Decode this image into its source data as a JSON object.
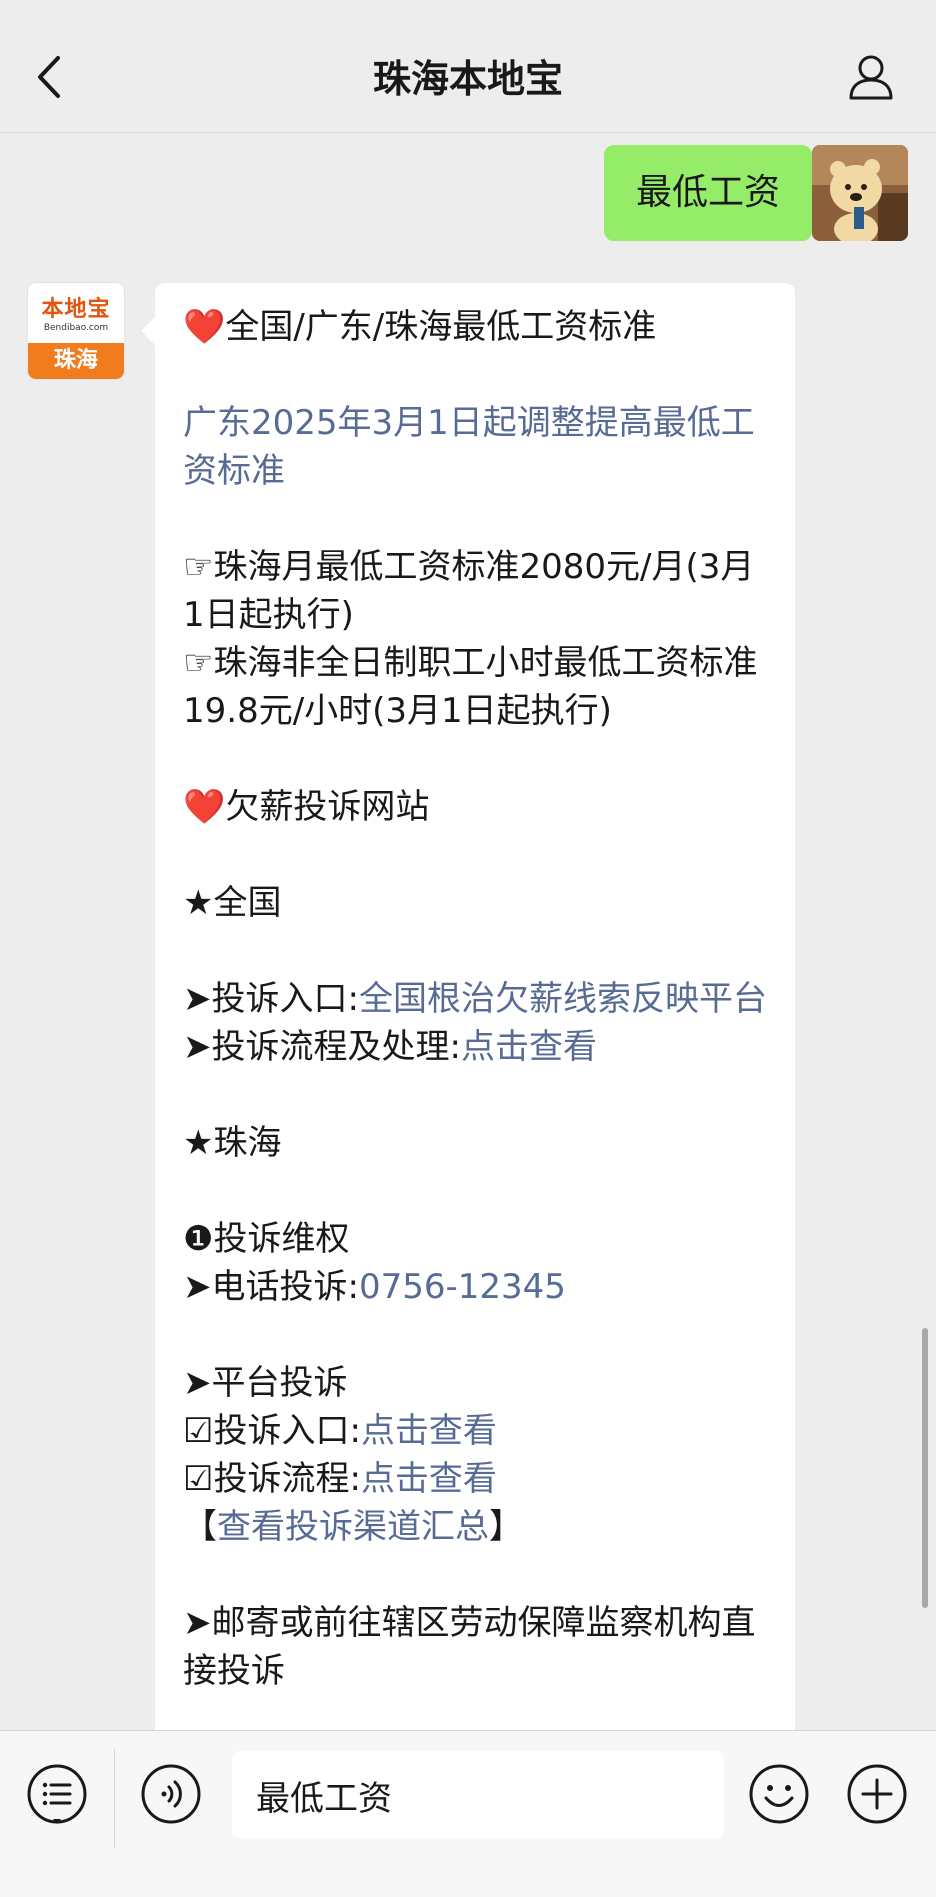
{
  "nav": {
    "title": "珠海本地宝"
  },
  "me": {
    "message": "最低工资"
  },
  "bot": {
    "avatar_brand": "本地宝",
    "avatar_domain": "Bendibao.com",
    "avatar_city": "珠海",
    "heading1": "全国/广东/珠海最低工资标准",
    "link_adjust": "广东2025年3月1日起调整提高最低工资标准",
    "monthly_prefix": "☞",
    "monthly_text": "珠海月最低工资标准2080元/月(3月1日起执行)",
    "hourly_prefix": "☞",
    "hourly_text": "珠海非全日制职工小时最低工资标准19.8元/小时(3月1日起执行)",
    "heading2": "欠薪投诉网站",
    "national_label": "★全国",
    "complaint_entry_label": "➤投诉入口:",
    "complaint_entry_link": "全国根治欠薪线索反映平台",
    "complaint_process_label": "➤投诉流程及处理:",
    "view_link": "点击查看",
    "zhuhai_label": "★珠海",
    "rights_label": "❶投诉维权",
    "phone_label": "➤电话投诉:",
    "phone_number": "0756-12345",
    "platform_label": "➤平台投诉",
    "entry_label": "☑投诉入口:",
    "entry_link": "点击查看",
    "process_label": "☑投诉流程:",
    "process_link": "点击查看",
    "bracket_open": "【",
    "channels_link": "查看投诉渠道汇总",
    "bracket_close": "】",
    "mail_text": "➤邮寄或前往辖区劳动保障监察机构直接投诉"
  },
  "input": {
    "value": "最低工资"
  },
  "icons": {
    "back": "chevron-left-icon",
    "profile": "person-icon",
    "menu": "list-menu-icon",
    "voice": "voice-icon",
    "emoji": "smiley-icon",
    "plus": "plus-icon",
    "heart": "heart-icon"
  },
  "colors": {
    "background": "#ededed",
    "my_bubble": "#95ec69",
    "their_bubble": "#ffffff",
    "link": "#576b95",
    "heart": "#e0201b",
    "brand_orange": "#f07c1e"
  }
}
